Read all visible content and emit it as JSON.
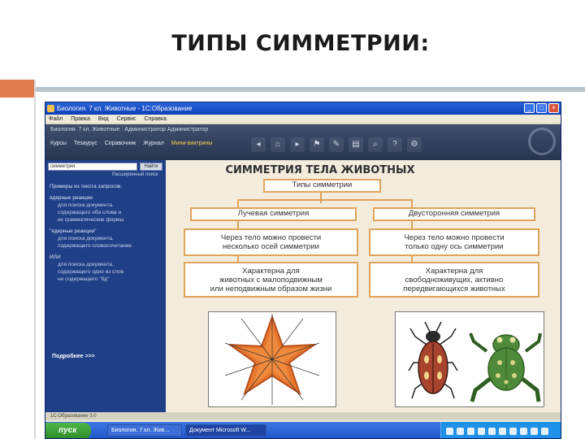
{
  "slide": {
    "title": "ТИПЫ СИММЕТРИИ:"
  },
  "window": {
    "title": "Биология. 7 кл. Животные - 1С:Образование",
    "menu": [
      "Файл",
      "Правка",
      "Вид",
      "Сервис",
      "Справка"
    ]
  },
  "app": {
    "breadcrumb": "Биология. 7 кл. Животные  ·  Администратор Администратор",
    "nav": [
      "Курсы",
      "Тезаурус",
      "Справочник",
      "Журнал",
      "Мини-виктрины"
    ]
  },
  "sidebar": {
    "search_value": "симметрия",
    "search_button": "Найти",
    "advanced_search": "Расширенный поиск",
    "lines": [
      {
        "text": "Примеры из текста запросов:",
        "indent": false
      },
      {
        "text": "",
        "indent": false,
        "gap": true
      },
      {
        "text": "ядерные реакции",
        "indent": false
      },
      {
        "text": "для поиска документа,",
        "indent": true
      },
      {
        "text": "содержащего оба слова и",
        "indent": true
      },
      {
        "text": "их грамматические формы",
        "indent": true
      },
      {
        "text": "",
        "indent": false,
        "gap": true
      },
      {
        "text": "\"ядерные реакции\"",
        "indent": false
      },
      {
        "text": "для поиска документа,",
        "indent": true
      },
      {
        "text": "содержащего словосочетание",
        "indent": true
      },
      {
        "text": "",
        "indent": false,
        "gap": true
      },
      {
        "text": "ИЛИ",
        "indent": false
      },
      {
        "text": "для поиска документа,",
        "indent": true
      },
      {
        "text": "содержащего одно из слов",
        "indent": true
      },
      {
        "text": "не содержащего \"бд\"",
        "indent": true
      }
    ],
    "more": "Подробнее >>>"
  },
  "content": {
    "title": "СИММЕТРИЯ ТЕЛА ЖИВОТНЫХ",
    "root": "Типы симметрии",
    "radial": {
      "name": "Лучевая симметрия",
      "desc": [
        "Через тело можно провести",
        "несколько осей симметрии"
      ],
      "habit": [
        "Характерна для",
        "животных с малоподвижным",
        "или неподвижным образом жизни"
      ]
    },
    "bilateral": {
      "name": "Двусторонняя симметрия",
      "desc": [
        "Через тело можно провести",
        "только одну ось симметрии"
      ],
      "habit": [
        "Характерна для",
        "свободноживущих, активно",
        "передвигающихся животных"
      ]
    }
  },
  "statusbar": "1С:Образование 3.0",
  "taskbar": {
    "start": "пуск",
    "items": [
      "Биология. 7 кл. Жив...",
      "Документ Microsoft W..."
    ]
  },
  "colors": {
    "accent": "#e07b4e",
    "box_border": "#e0a35a",
    "sidebar": "#1f3f86",
    "starfish": "#e8772e",
    "beetle": "#a8432e",
    "frog": "#4f8a3a"
  }
}
